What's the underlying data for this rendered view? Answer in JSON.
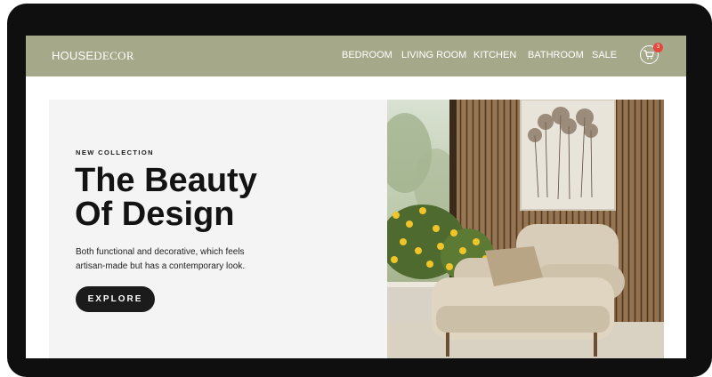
{
  "header": {
    "logo_part1": "HOUSE",
    "logo_part2": "DECOR",
    "nav": [
      "BEDROOM",
      "LIVING ROOM",
      "KITCHEN",
      "BATHROOM",
      "SALE"
    ],
    "cart_count": "3"
  },
  "hero": {
    "eyebrow": "NEW COLLECTION",
    "title_line1": "The Beauty",
    "title_line2": "Of Design",
    "description_line1": "Both functional and decorative, which feels",
    "description_line2": "artisan-made but has a contemporary look.",
    "cta_label": "EXPLORE"
  },
  "colors": {
    "navbar": "#a5a98a",
    "hero_panel": "#f4f4f4",
    "button": "#1b1b1b",
    "badge": "#e8453c",
    "device_frame": "#0f0f10"
  },
  "icons": [
    "cart-icon"
  ]
}
